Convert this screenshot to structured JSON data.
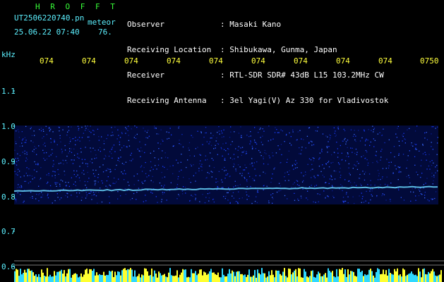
{
  "header": {
    "app_name": "H R O F F T",
    "filename": "UT2506220740.pn",
    "mode": "meteor",
    "datetime": "25.06.22 07:40",
    "level": "76.",
    "info_labels": [
      "Observer",
      "Receiving Location",
      "Receiver",
      "Receiving Antenna"
    ],
    "info_values": [
      ": Masaki Kano",
      ": Shibukawa, Gunma, Japan",
      ": RTL-SDR SDR# 43dB L15 103.2MHz CW",
      ": 3el Yagi(V) Az 330 for Vladivostok"
    ]
  },
  "spectrogram": {
    "freq_unit": "kHz",
    "y_ticks": [
      "1.1",
      "1.0",
      "0.9",
      "0.8",
      "0.7",
      "0.6"
    ],
    "time_ticks": [
      "074",
      "074",
      "074",
      "074",
      "074",
      "074",
      "074",
      "074",
      "074",
      "0750"
    ],
    "colors": {
      "label": "#5cf0ff",
      "title": "#38ff38",
      "time": "#ffff3c",
      "text": "#ffffff",
      "signal": "#1a3cff",
      "band": "#6ad8ff"
    }
  }
}
